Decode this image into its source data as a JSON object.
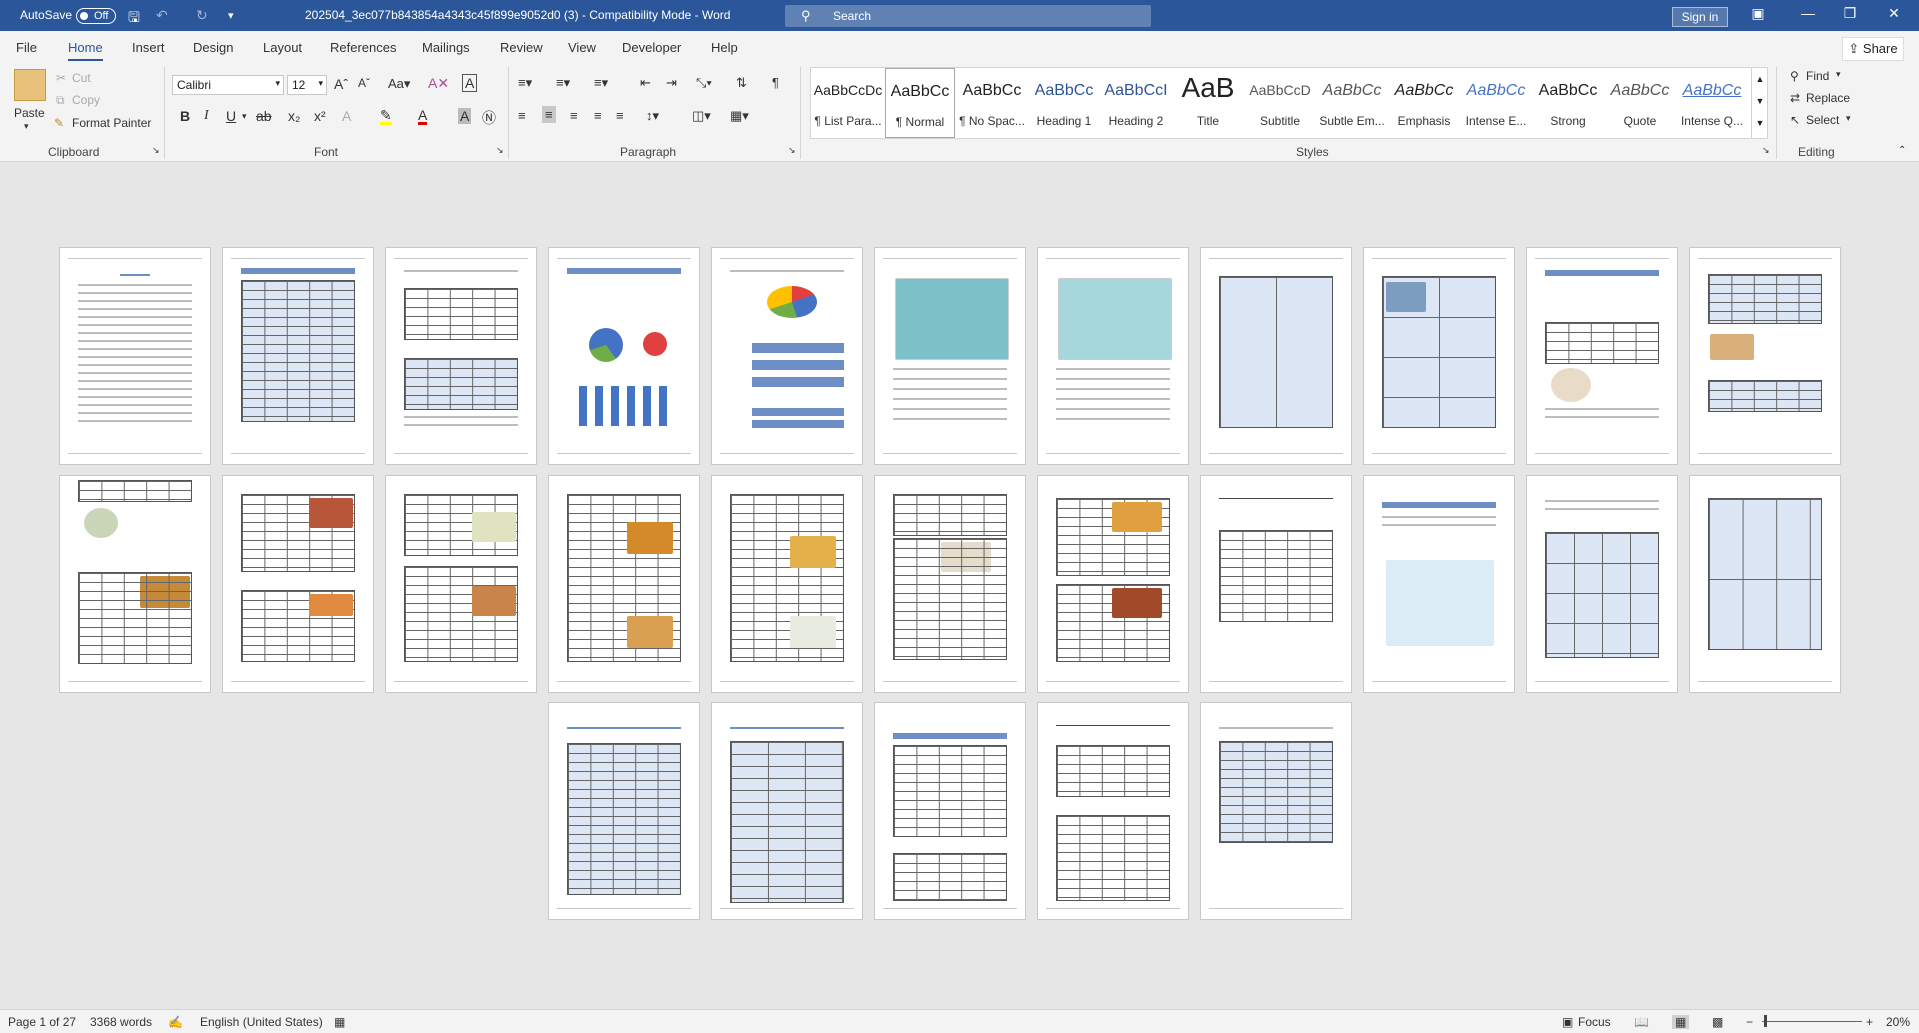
{
  "titlebar": {
    "autosave_label": "AutoSave",
    "autosave_state": "Off",
    "doc_title": "202504_3ec077b843854a4343c45f899e9052d0 (3)  -  Compatibility Mode  -  Word",
    "search_placeholder": "Search",
    "signin_label": "Sign in"
  },
  "tabs": [
    "File",
    "Home",
    "Insert",
    "Design",
    "Layout",
    "References",
    "Mailings",
    "Review",
    "View",
    "Developer",
    "Help"
  ],
  "active_tab": "Home",
  "share_label": "Share",
  "clipboard": {
    "paste": "Paste",
    "cut": "Cut",
    "copy": "Copy",
    "format_painter": "Format Painter",
    "group_label": "Clipboard"
  },
  "font": {
    "name": "Calibri",
    "size": "12",
    "group_label": "Font"
  },
  "paragraph": {
    "group_label": "Paragraph"
  },
  "styles": {
    "group_label": "Styles",
    "items": [
      {
        "sample": "AaBbCcDc",
        "name": "¶ List Para..."
      },
      {
        "sample": "AaBbCc",
        "name": "¶ Normal"
      },
      {
        "sample": "AaBbCc",
        "name": "¶ No Spac..."
      },
      {
        "sample": "AaBbCc",
        "name": "Heading 1"
      },
      {
        "sample": "AaBbCcI",
        "name": "Heading 2"
      },
      {
        "sample": "AaB",
        "name": "Title"
      },
      {
        "sample": "AaBbCcD",
        "name": "Subtitle"
      },
      {
        "sample": "AaBbCc",
        "name": "Subtle Em..."
      },
      {
        "sample": "AaBbCc",
        "name": "Emphasis"
      },
      {
        "sample": "AaBbCc",
        "name": "Intense E..."
      },
      {
        "sample": "AaBbCc",
        "name": "Strong"
      },
      {
        "sample": "AaBbCc",
        "name": "Quote"
      },
      {
        "sample": "AaBbCc",
        "name": "Intense Q..."
      }
    ]
  },
  "editing": {
    "find": "Find",
    "replace": "Replace",
    "select": "Select",
    "group_label": "Editing"
  },
  "status": {
    "page": "Page 1 of 27",
    "words": "3368 words",
    "language": "English (United States)",
    "focus": "Focus",
    "zoom": "20%"
  },
  "pages_count": 27
}
